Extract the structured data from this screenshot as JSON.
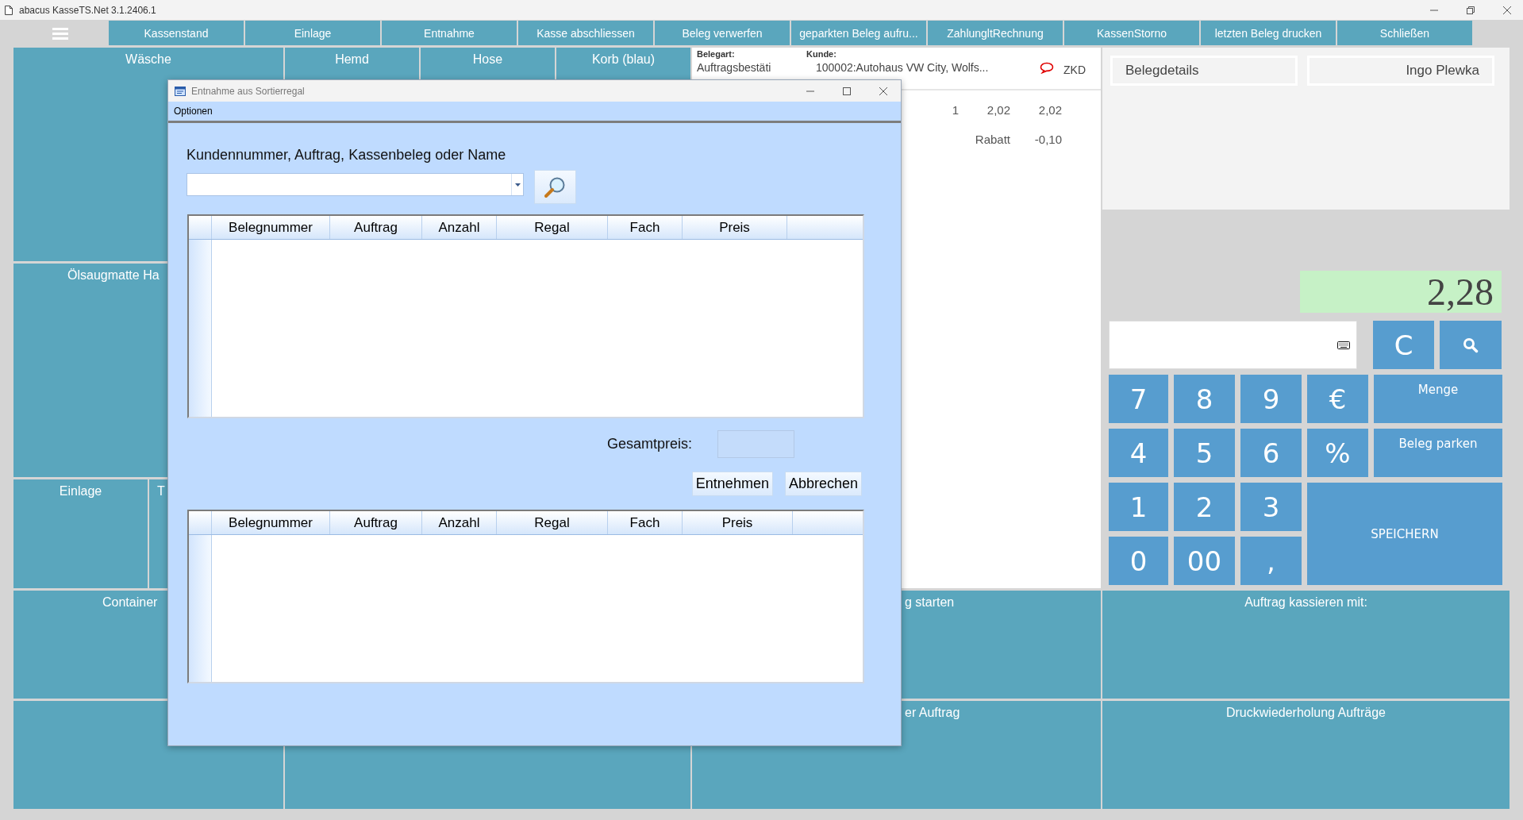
{
  "window": {
    "title": "abacus KasseTS.Net 3.1.2406.1"
  },
  "toolbar": {
    "buttons": [
      "Kassenstand",
      "Einlage",
      "Entnahme",
      "Kasse abschliessen",
      "Beleg verwerfen",
      "geparkten Beleg aufru...",
      "ZahlungltRechnung",
      "KassenStorno",
      "letzten Beleg drucken",
      "Schließen"
    ]
  },
  "tiles": [
    {
      "label": "Wäsche"
    },
    {
      "label": "Hemd"
    },
    {
      "label": "Hose"
    },
    {
      "label": "Korb (blau)"
    },
    {
      "label": "Ölsaugmatte Ha"
    },
    {
      "label": "Einlage"
    },
    {
      "label": "T"
    },
    {
      "label": "Container"
    },
    {
      "label": "g starten"
    },
    {
      "label": "Auftrag kassieren mit:"
    },
    {
      "label": "er Auftrag"
    },
    {
      "label": "Druckwiederholung Aufträge"
    }
  ],
  "receipt": {
    "doc_type_label": "Belegart:",
    "doc_type": "Auftragsbestäti",
    "customer_label": "Kunde:",
    "customer": "100002:Autohaus VW City, Wolfs...",
    "customer_flag": "ZKD",
    "lines": [
      {
        "kind": "item",
        "qty": "1",
        "price": "2,02",
        "total": "2,02"
      },
      {
        "kind": "discount",
        "label": "Rabatt",
        "total": "-0,10"
      }
    ]
  },
  "details": {
    "button": "Belegdetails",
    "user": "Ingo Plewka"
  },
  "display": "2,28",
  "keypad": {
    "clear": "C",
    "keys": [
      {
        "label": "7",
        "kind": "digit"
      },
      {
        "label": "8",
        "kind": "digit"
      },
      {
        "label": "9",
        "kind": "digit"
      },
      {
        "label": "€",
        "kind": "digit"
      },
      {
        "label": "Menge",
        "kind": "action"
      },
      {
        "label": "4",
        "kind": "digit"
      },
      {
        "label": "5",
        "kind": "digit"
      },
      {
        "label": "6",
        "kind": "digit"
      },
      {
        "label": "%",
        "kind": "digit"
      },
      {
        "label": "Beleg parken",
        "kind": "action"
      },
      {
        "label": "1",
        "kind": "digit"
      },
      {
        "label": "2",
        "kind": "digit"
      },
      {
        "label": "3",
        "kind": "digit"
      },
      {
        "label": "SPEICHERN",
        "kind": "save"
      },
      {
        "label": "0",
        "kind": "digit"
      },
      {
        "label": "00",
        "kind": "digit"
      },
      {
        "label": ",",
        "kind": "digit"
      }
    ]
  },
  "dialog": {
    "title": "Entnahme aus Sortierregal",
    "menu": [
      "Optionen"
    ],
    "search_label": "Kundennummer, Auftrag, Kassenbeleg oder Name",
    "grid_top": {
      "columns": [
        "Belegnummer",
        "Auftrag",
        "Anzahl",
        "Regal",
        "Fach",
        "Preis"
      ]
    },
    "total_label": "Gesamtpreis:",
    "buttons": [
      "Entnehmen",
      "Abbrechen"
    ],
    "grid_bottom": {
      "columns": [
        "Belegnummer",
        "Auftrag",
        "Anzahl",
        "Regal",
        "Fach",
        "Preis"
      ]
    }
  }
}
